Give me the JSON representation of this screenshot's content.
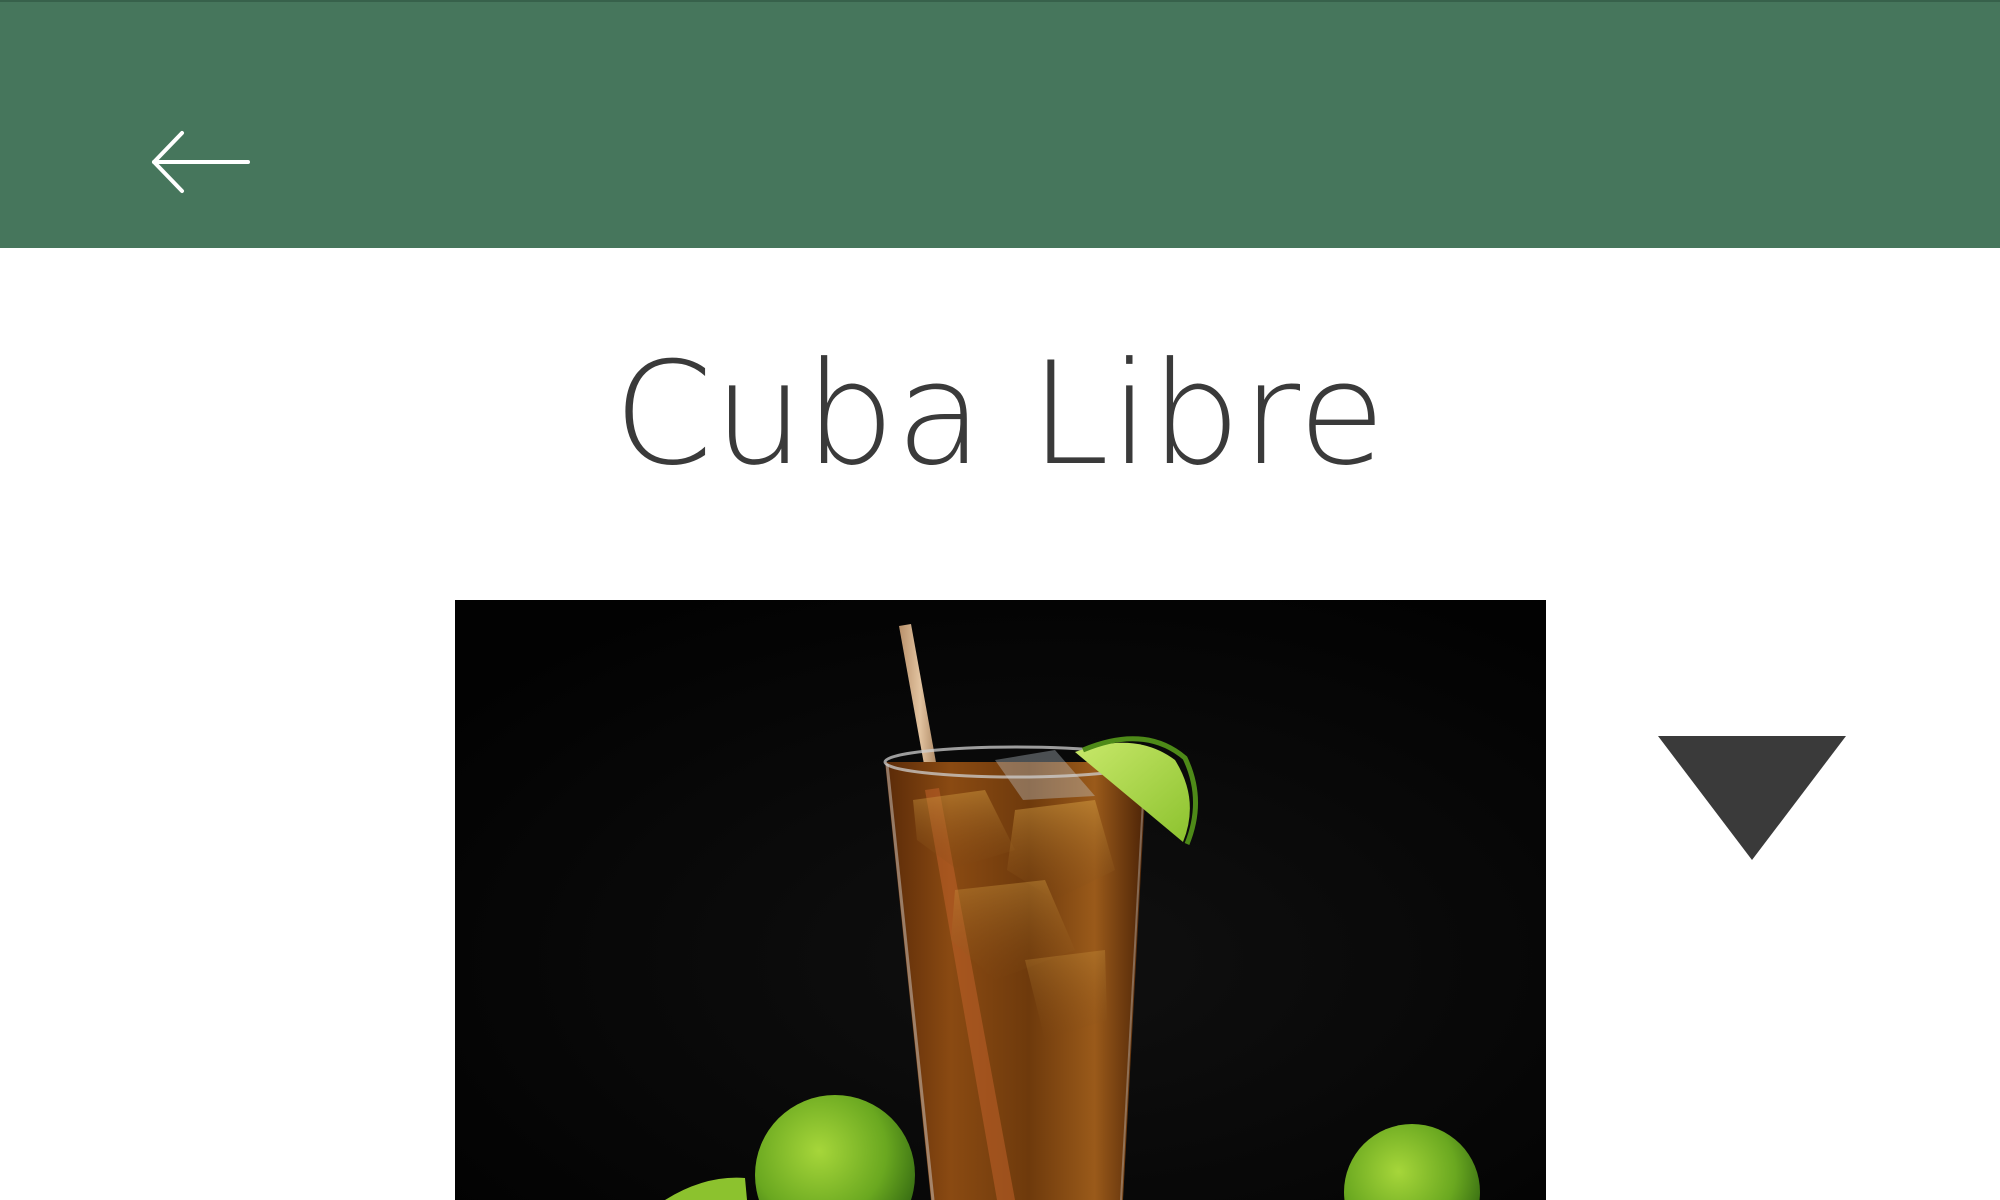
{
  "header": {
    "background_color": "#46765c",
    "back_icon": "arrow-left-icon"
  },
  "drink": {
    "name": "Cuba Libre",
    "image": "cuba-libre-glass-with-lime-photo"
  },
  "toggle": {
    "icon": "triangle-down-icon",
    "color": "#3a3a3a"
  }
}
